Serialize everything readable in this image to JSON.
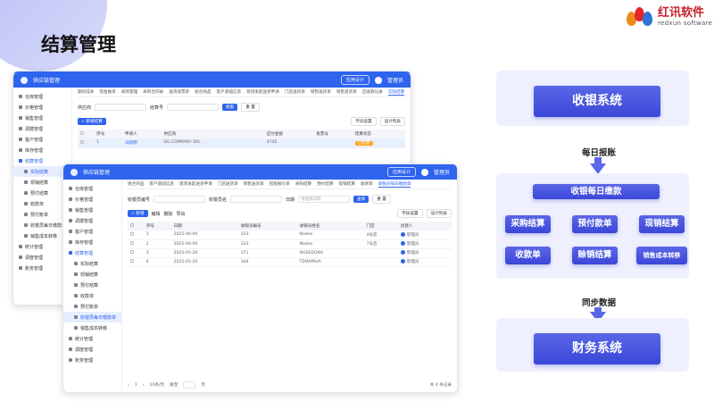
{
  "slide": {
    "title": "结算管理"
  },
  "logo": {
    "cn": "红讯软件",
    "en": "redxun software"
  },
  "app": {
    "title": "供应链管理",
    "design_btn": "应用设计",
    "user": "管理员",
    "back_tabs": [
      "期初成本",
      "现金账单",
      "采购管理",
      "采购合同录",
      "送货收票单",
      "组合商品",
      "客户基础信息",
      "现场发起送货申请",
      "门店送货单",
      "销售送货单",
      "销售退货单",
      "应收款记录",
      "实际结算"
    ],
    "front_tabs": [
      "组合商品",
      "客户基础信息",
      "现场发起送货申请",
      "门店送货单",
      "销售送货单",
      "智能报价单",
      "采购结算",
      "预付结算",
      "现销结算",
      "收款单",
      "收银员每日缴款单"
    ],
    "sidebar": [
      "仓库管理",
      "价格管理",
      "销售管理",
      "调拨管理",
      "客户管理",
      "库存管理",
      "结算管理",
      "实际结算",
      "现销结算",
      "预付结算",
      "收款单",
      "预付账单",
      "收银员每日缴款单",
      "销售成本转移",
      "统计管理",
      "调度管理",
      "账务管理"
    ],
    "back_filter": {
      "supplier": "供应商",
      "settle_no": "结算号",
      "search": "搜索",
      "reset": "重 置"
    },
    "front_filter": {
      "cashier_no": "收银员编号",
      "cashier_name": "收银员名",
      "date": "日期",
      "date_ph": "请选择日期",
      "search": "查询",
      "reset": "重 置"
    },
    "back_toolbar": {
      "add": "+ 新增结算",
      "field": "字段设置",
      "design": "设计列表"
    },
    "front_toolbar": {
      "add": "+ 新增",
      "edit": "编辑",
      "del": "删除",
      "exp": "导出",
      "field": "字段设置",
      "design": "设计列表"
    },
    "back_cols": [
      "",
      "序号",
      "申请人",
      "供应商",
      "应付金额",
      "发票号",
      "结算状态"
    ],
    "back_row": [
      "",
      "1",
      "马晓明",
      "DG COMPANY SRL",
      "4745",
      "",
      "已结算"
    ],
    "front_cols": [
      "",
      "序号",
      "日期",
      "收银员编号",
      "收银员姓名",
      "门店",
      "创建人"
    ],
    "front_rows": [
      [
        "",
        "1",
        "2025-06-06",
        "333",
        "Nadeo",
        "4号店",
        "管理员"
      ],
      [
        "",
        "2",
        "2025-06-06",
        "333",
        "Nadeo",
        "7号店",
        "管理员"
      ],
      [
        "",
        "3",
        "2025-05-26",
        "371",
        "NOSEDONA",
        "",
        "管理员"
      ],
      [
        "",
        "4",
        "2025-05-26",
        "344",
        "TEMAPAVA",
        "",
        "管理员"
      ]
    ],
    "pager": {
      "size": "20条/页",
      "jump": "跳至",
      "page": "页",
      "total": "共 4 条记录"
    }
  },
  "flow": {
    "pos": "收银系统",
    "daily": "每日报账",
    "daily_pay": "收银每日缴款",
    "items": [
      "采购结算",
      "预付款单",
      "现销结算",
      "收款单",
      "赊销结算",
      "销售成本转移"
    ],
    "sync": "同步数据",
    "finance": "财务系统"
  }
}
